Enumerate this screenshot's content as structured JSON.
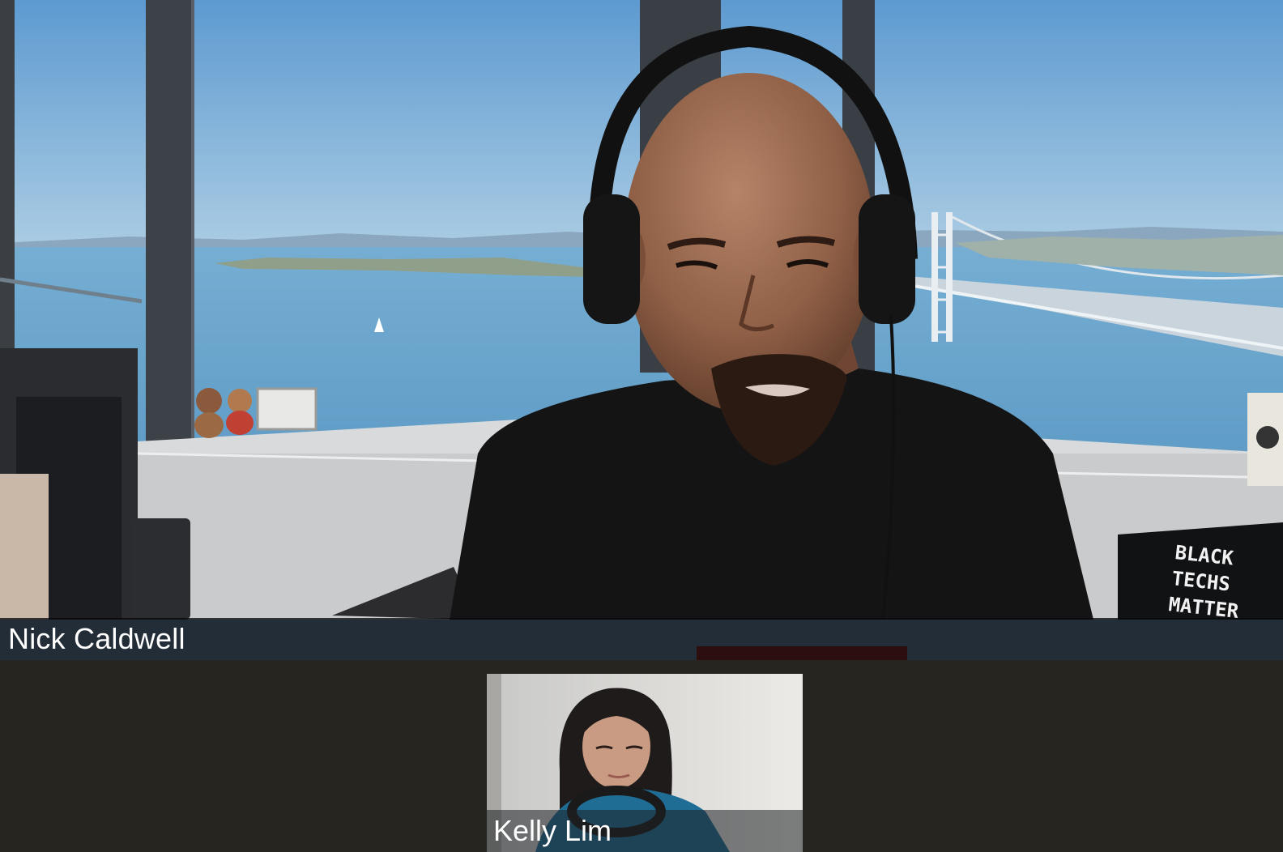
{
  "meeting": {
    "main_participant": {
      "name": "Nick Caldwell",
      "shirt_text": "BLACK TECHS MATTER"
    },
    "thumbnail_participant": {
      "name": "Kelly Lim"
    }
  },
  "colors": {
    "stage_background": "#26251f",
    "name_bar": "#08080a",
    "name_text": "#ffffff",
    "sky": "#7fb1d6",
    "water": "#6aa3c9"
  },
  "icons": {
    "headphones": "headphones-icon"
  }
}
